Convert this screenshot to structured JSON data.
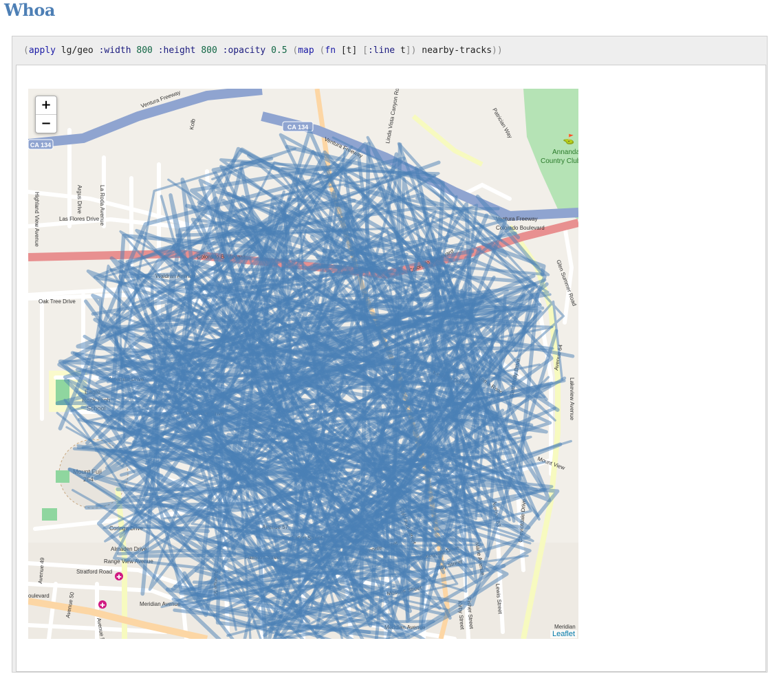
{
  "page": {
    "title": "Whoa"
  },
  "code": {
    "open": "(",
    "apply": "apply",
    "ns": "lg/geo",
    "width_kw": ":width",
    "width_val": "800",
    "height_kw": ":height",
    "height_val": "800",
    "opacity_kw": ":opacity",
    "opacity_val": "0.5",
    "map_open": "(",
    "map": "map",
    "fn_open": "(",
    "fn": "fn",
    "args": "[t]",
    "line_vec_open": "[",
    "line_kw": ":line",
    "line_arg": "t",
    "line_vec_close": "]",
    "fn_close": ")",
    "tracks": "nearby-tracks",
    "close": "))"
  },
  "map": {
    "track_color": "#4a7fb5",
    "track_opacity": 0.5,
    "zoom_in": "+",
    "zoom_out": "−",
    "attribution": "Leaflet",
    "labels": {
      "ventura_fwy_1": "Ventura Freeway",
      "ventura_fwy_2": "Ventura Freeway",
      "ventura_fwy_3": "Ventura Freeway",
      "ca134": "CA 134",
      "ca134b": "CA 134",
      "colorado_blvd": "Colorado Boulevard",
      "colorado_blvd2": "Colorado Boulevard",
      "colorado_blvd3": "Colorado Boulevard",
      "annandale_1": "Annandale",
      "annandale_2": "Country Club",
      "las_flores": "Las Flores Drive",
      "highland_view": "Highland View Avenue",
      "argus": "Argus Drive",
      "la_roda": "La Roda Avenue",
      "oak_tree": "Oak Tree Drive",
      "yosemite": "Yosemite Drive",
      "rock_high_1": "Eagle",
      "rock_high_2": "Rock High",
      "rock_high_3": "School",
      "mount_fuji": "Mount Fuji",
      "mount_264": "264",
      "oak_grove": "Oak Grove Drive",
      "waldran": "Waldran Avenue",
      "coringa": "Coringa Drive",
      "almaden": "Almaden Drive",
      "range_view": "Range View Avenue",
      "stratford": "Stratford Road",
      "meridian": "Meridian Avenue",
      "meridian2": "Meridian Avenue",
      "blvd_left": "oulevard",
      "avenue_50": "Avenue 50",
      "avenue_51": "Avenue 51",
      "avenue_49": "Avenue 49",
      "avenue_55": "Avenue 55",
      "avenue_57": "Avenue 57",
      "avenue_63": "Avenue 63",
      "avenue_64": "Avenue 64",
      "falliston": "Falliston Street",
      "eaton": "Eaton Street",
      "delmonte": "Delmonte Street",
      "springvale": "Springvale Drive",
      "roy": "Roy Street",
      "mosotis": "Mosotis Street",
      "kirby": "Kirby Street",
      "fisher": "Fisher Street",
      "lewis": "Lewis Street",
      "marie": "Marie Avenue",
      "glen_summer": "Glen Summer Road",
      "lakeview": "Lakeview Avenue",
      "patrician": "Patrician Way",
      "la_loma": "La Loma Road",
      "keweah": "Keweah Drive",
      "glen_holly": "Glen Holly Drive",
      "mount_view": "Mount View",
      "cheviotdale": "Cheviotdale Drive",
      "colorado_st": "Colorado Street",
      "lincoln_canyon": "Linda Vista Canyon Road",
      "kolb": "Kolb",
      "merdian_r": "Meridian"
    }
  }
}
